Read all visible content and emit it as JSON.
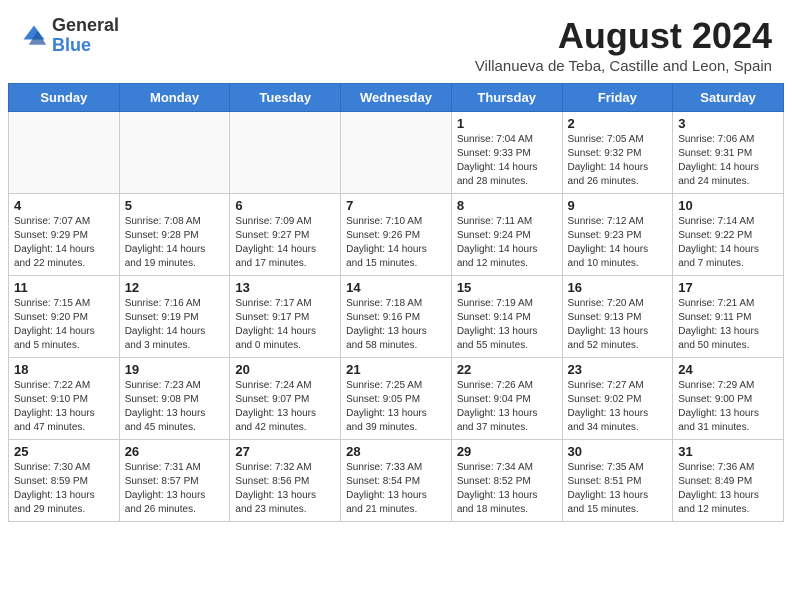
{
  "header": {
    "logo_general": "General",
    "logo_blue": "Blue",
    "month_year": "August 2024",
    "location": "Villanueva de Teba, Castille and Leon, Spain"
  },
  "weekdays": [
    "Sunday",
    "Monday",
    "Tuesday",
    "Wednesday",
    "Thursday",
    "Friday",
    "Saturday"
  ],
  "weeks": [
    [
      {
        "day": "",
        "info": ""
      },
      {
        "day": "",
        "info": ""
      },
      {
        "day": "",
        "info": ""
      },
      {
        "day": "",
        "info": ""
      },
      {
        "day": "1",
        "info": "Sunrise: 7:04 AM\nSunset: 9:33 PM\nDaylight: 14 hours and 28 minutes."
      },
      {
        "day": "2",
        "info": "Sunrise: 7:05 AM\nSunset: 9:32 PM\nDaylight: 14 hours and 26 minutes."
      },
      {
        "day": "3",
        "info": "Sunrise: 7:06 AM\nSunset: 9:31 PM\nDaylight: 14 hours and 24 minutes."
      }
    ],
    [
      {
        "day": "4",
        "info": "Sunrise: 7:07 AM\nSunset: 9:29 PM\nDaylight: 14 hours and 22 minutes."
      },
      {
        "day": "5",
        "info": "Sunrise: 7:08 AM\nSunset: 9:28 PM\nDaylight: 14 hours and 19 minutes."
      },
      {
        "day": "6",
        "info": "Sunrise: 7:09 AM\nSunset: 9:27 PM\nDaylight: 14 hours and 17 minutes."
      },
      {
        "day": "7",
        "info": "Sunrise: 7:10 AM\nSunset: 9:26 PM\nDaylight: 14 hours and 15 minutes."
      },
      {
        "day": "8",
        "info": "Sunrise: 7:11 AM\nSunset: 9:24 PM\nDaylight: 14 hours and 12 minutes."
      },
      {
        "day": "9",
        "info": "Sunrise: 7:12 AM\nSunset: 9:23 PM\nDaylight: 14 hours and 10 minutes."
      },
      {
        "day": "10",
        "info": "Sunrise: 7:14 AM\nSunset: 9:22 PM\nDaylight: 14 hours and 7 minutes."
      }
    ],
    [
      {
        "day": "11",
        "info": "Sunrise: 7:15 AM\nSunset: 9:20 PM\nDaylight: 14 hours and 5 minutes."
      },
      {
        "day": "12",
        "info": "Sunrise: 7:16 AM\nSunset: 9:19 PM\nDaylight: 14 hours and 3 minutes."
      },
      {
        "day": "13",
        "info": "Sunrise: 7:17 AM\nSunset: 9:17 PM\nDaylight: 14 hours and 0 minutes."
      },
      {
        "day": "14",
        "info": "Sunrise: 7:18 AM\nSunset: 9:16 PM\nDaylight: 13 hours and 58 minutes."
      },
      {
        "day": "15",
        "info": "Sunrise: 7:19 AM\nSunset: 9:14 PM\nDaylight: 13 hours and 55 minutes."
      },
      {
        "day": "16",
        "info": "Sunrise: 7:20 AM\nSunset: 9:13 PM\nDaylight: 13 hours and 52 minutes."
      },
      {
        "day": "17",
        "info": "Sunrise: 7:21 AM\nSunset: 9:11 PM\nDaylight: 13 hours and 50 minutes."
      }
    ],
    [
      {
        "day": "18",
        "info": "Sunrise: 7:22 AM\nSunset: 9:10 PM\nDaylight: 13 hours and 47 minutes."
      },
      {
        "day": "19",
        "info": "Sunrise: 7:23 AM\nSunset: 9:08 PM\nDaylight: 13 hours and 45 minutes."
      },
      {
        "day": "20",
        "info": "Sunrise: 7:24 AM\nSunset: 9:07 PM\nDaylight: 13 hours and 42 minutes."
      },
      {
        "day": "21",
        "info": "Sunrise: 7:25 AM\nSunset: 9:05 PM\nDaylight: 13 hours and 39 minutes."
      },
      {
        "day": "22",
        "info": "Sunrise: 7:26 AM\nSunset: 9:04 PM\nDaylight: 13 hours and 37 minutes."
      },
      {
        "day": "23",
        "info": "Sunrise: 7:27 AM\nSunset: 9:02 PM\nDaylight: 13 hours and 34 minutes."
      },
      {
        "day": "24",
        "info": "Sunrise: 7:29 AM\nSunset: 9:00 PM\nDaylight: 13 hours and 31 minutes."
      }
    ],
    [
      {
        "day": "25",
        "info": "Sunrise: 7:30 AM\nSunset: 8:59 PM\nDaylight: 13 hours and 29 minutes."
      },
      {
        "day": "26",
        "info": "Sunrise: 7:31 AM\nSunset: 8:57 PM\nDaylight: 13 hours and 26 minutes."
      },
      {
        "day": "27",
        "info": "Sunrise: 7:32 AM\nSunset: 8:56 PM\nDaylight: 13 hours and 23 minutes."
      },
      {
        "day": "28",
        "info": "Sunrise: 7:33 AM\nSunset: 8:54 PM\nDaylight: 13 hours and 21 minutes."
      },
      {
        "day": "29",
        "info": "Sunrise: 7:34 AM\nSunset: 8:52 PM\nDaylight: 13 hours and 18 minutes."
      },
      {
        "day": "30",
        "info": "Sunrise: 7:35 AM\nSunset: 8:51 PM\nDaylight: 13 hours and 15 minutes."
      },
      {
        "day": "31",
        "info": "Sunrise: 7:36 AM\nSunset: 8:49 PM\nDaylight: 13 hours and 12 minutes."
      }
    ]
  ]
}
